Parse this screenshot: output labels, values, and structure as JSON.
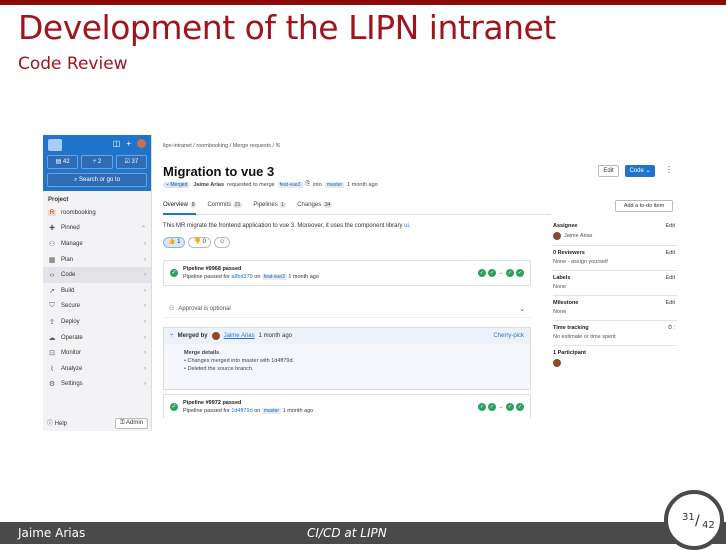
{
  "slide": {
    "title": "Development of the LIPN intranet",
    "subtitle": "Code Review",
    "footer_author": "Jaime Arias",
    "footer_center": "CI/CD at LIPN",
    "page_current": "31",
    "page_total": "42"
  },
  "sidebar": {
    "counts": [
      "42",
      "2",
      "37"
    ],
    "search": "Search or go to",
    "project_label": "Project",
    "project_name": "roombooking",
    "items": [
      {
        "label": "Pinned",
        "icon": "pin-icon"
      },
      {
        "label": "Manage",
        "icon": "users-icon"
      },
      {
        "label": "Plan",
        "icon": "calendar-icon"
      },
      {
        "label": "Code",
        "icon": "code-icon"
      },
      {
        "label": "Build",
        "icon": "rocket-icon"
      },
      {
        "label": "Secure",
        "icon": "shield-icon"
      },
      {
        "label": "Deploy",
        "icon": "deploy-icon"
      },
      {
        "label": "Operate",
        "icon": "cloud-icon"
      },
      {
        "label": "Monitor",
        "icon": "monitor-icon"
      },
      {
        "label": "Analyze",
        "icon": "chart-icon"
      },
      {
        "label": "Settings",
        "icon": "gear-icon"
      }
    ],
    "help": "Help",
    "admin": "Admin"
  },
  "mr": {
    "breadcrumb": "lipn-intranet / roombooking / Merge requests / !6",
    "title": "Migration to vue 3",
    "edit": "Edit",
    "code": "Code",
    "status": "Merged",
    "author": "Jaime Arias",
    "merge_text": "requested to merge",
    "source_branch": "feat-vue3",
    "into": "into",
    "target_branch": "master",
    "time": "1 month ago",
    "tabs": [
      {
        "label": "Overview",
        "count": "0"
      },
      {
        "label": "Commits",
        "count": "21"
      },
      {
        "label": "Pipelines",
        "count": "1"
      },
      {
        "label": "Changes",
        "count": "34"
      }
    ],
    "add_review": "Add a to-do item",
    "description": "This MR migrate the frontend application to vue 3. Moreover, it uses the component library",
    "description_link": "ui",
    "reactions": [
      "1",
      "0"
    ]
  },
  "pipelines": [
    {
      "label": "Pipeline #9968 passed",
      "details_prefix": "Pipeline passed for",
      "commit": "a8bd379",
      "on": "on",
      "branch": "feat-vue3",
      "time": "1 month ago"
    },
    {
      "label": "Pipeline #9972 passed",
      "details_prefix": "Pipeline passed for",
      "commit": "1d4ff79d",
      "on": "on",
      "branch": "master",
      "time": "1 month ago"
    }
  ],
  "approve": "Approval is optional",
  "merged": {
    "prefix": "Merged by",
    "user": "Jaime Arias",
    "time": "1 month ago",
    "cherry": "Cherry-pick",
    "details_title": "Merge details",
    "detail1": "Changes merged into master with 1d4ff79d.",
    "detail2": "Deleted the source branch."
  },
  "right": {
    "assignee_label": "Assignee",
    "assignee": "Jaime Arias",
    "reviewers_label": "0 Reviewers",
    "reviewers": "None - assign yourself",
    "labels_label": "Labels",
    "labels": "None",
    "milestone_label": "Milestone",
    "milestone": "None",
    "time_label": "Time tracking",
    "time": "No estimate or time spent",
    "participants_label": "1 Participant",
    "edit": "Edit"
  }
}
